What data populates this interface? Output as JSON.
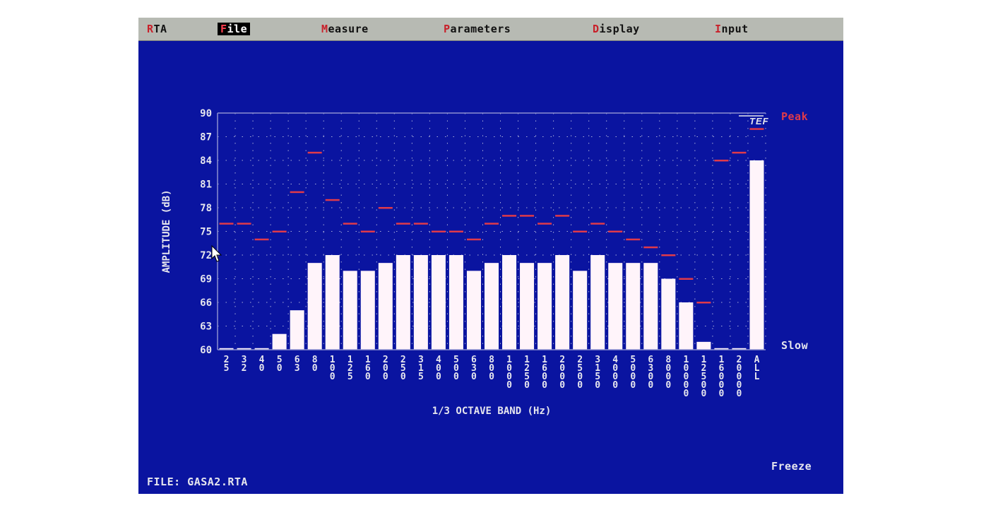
{
  "menu": {
    "items": [
      {
        "hot": "R",
        "rest": "TA",
        "selected": false,
        "name": "menu-rta",
        "interactable": true
      },
      {
        "hot": "F",
        "rest": "ile",
        "selected": true,
        "name": "menu-file",
        "interactable": true
      },
      {
        "hot": "M",
        "rest": "easure",
        "selected": false,
        "name": "menu-measure",
        "interactable": true
      },
      {
        "hot": "P",
        "rest": "arameters",
        "selected": false,
        "name": "menu-parameters",
        "interactable": true
      },
      {
        "hot": "D",
        "rest": "isplay",
        "selected": false,
        "name": "menu-display",
        "interactable": true
      },
      {
        "hot": "I",
        "rest": "nput",
        "selected": false,
        "name": "menu-input",
        "interactable": true
      }
    ]
  },
  "status": {
    "peak_label": "Peak",
    "slow_label": "Slow",
    "freeze_label": "Freeze",
    "file_label": "FILE: GASA2.RTA"
  },
  "logo_text": "TEF",
  "colors": {
    "background": "#0a14a0",
    "bar": "#fff4fa",
    "peak_marker": "#e03a4a",
    "axis_text": "#e6e6ee",
    "menu_bg": "#b7bab3",
    "hotkey": "#c8202a",
    "grid_dot": "#a8acd8"
  },
  "chart_data": {
    "type": "bar",
    "xlabel": "1/3 OCTAVE BAND (Hz)",
    "ylabel": "AMPLITUDE (dB)",
    "ylim": [
      60,
      90
    ],
    "yticks": [
      90,
      87,
      84,
      81,
      78,
      75,
      72,
      69,
      66,
      63,
      60
    ],
    "grid": "dotted",
    "categories": [
      "25",
      "32",
      "40",
      "50",
      "63",
      "80",
      "100",
      "125",
      "160",
      "200",
      "250",
      "315",
      "400",
      "500",
      "630",
      "800",
      "1000",
      "1250",
      "1600",
      "2000",
      "2500",
      "3150",
      "4000",
      "5000",
      "6300",
      "8000",
      "10000",
      "12500",
      "16000",
      "20000",
      "ALL"
    ],
    "series": [
      {
        "name": "Slow",
        "values": [
          60.2,
          60.2,
          60.2,
          62,
          65,
          71,
          72,
          70,
          70,
          71,
          72,
          72,
          72,
          72,
          70,
          71,
          72,
          71,
          71,
          72,
          70,
          72,
          71,
          71,
          71,
          69,
          66,
          61,
          60.2,
          60.2,
          84
        ]
      },
      {
        "name": "Peak",
        "values": [
          76,
          76,
          74,
          75,
          80,
          85,
          79,
          76,
          75,
          78,
          76,
          76,
          75,
          75,
          74,
          76,
          77,
          77,
          76,
          77,
          75,
          76,
          75,
          74,
          73,
          72,
          69,
          66,
          84,
          85,
          88
        ]
      }
    ]
  }
}
